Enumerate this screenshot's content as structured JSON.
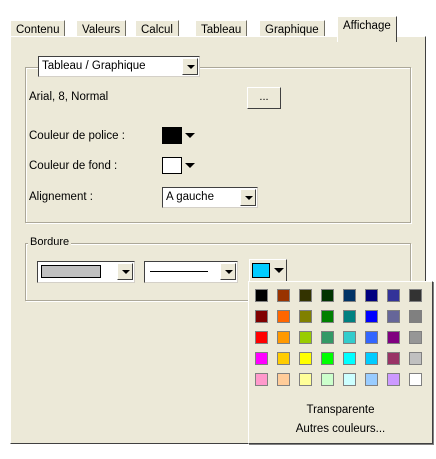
{
  "tabs": [
    "Contenu",
    "Valeurs",
    "Calcul",
    "Tableau",
    "Graphique",
    "Affichage"
  ],
  "active_tab": "Affichage",
  "group1": {
    "target_select": "Tableau / Graphique",
    "font_desc": "Arial, 8, Normal",
    "font_button": "...",
    "font_color_label": "Couleur de police :",
    "font_color": "#000000",
    "bg_color_label": "Couleur de fond :",
    "bg_color": "#ffffff",
    "align_label": "Alignement :",
    "align_value": "A gauche"
  },
  "border": {
    "legend": "Bordure",
    "fill_color": "#c0c0c0",
    "line_color": "#00ccff"
  },
  "palette": {
    "colors": [
      [
        "#000000",
        "#993300",
        "#333300",
        "#003300",
        "#003366",
        "#000080",
        "#333399",
        "#333333"
      ],
      [
        "#800000",
        "#ff6600",
        "#808000",
        "#008000",
        "#008080",
        "#0000ff",
        "#666699",
        "#808080"
      ],
      [
        "#ff0000",
        "#ff9900",
        "#99cc00",
        "#339966",
        "#33cccc",
        "#3366ff",
        "#800080",
        "#969696"
      ],
      [
        "#ff00ff",
        "#ffcc00",
        "#ffff00",
        "#00ff00",
        "#00ffff",
        "#00ccff",
        "#993366",
        "#c0c0c0"
      ],
      [
        "#ff99cc",
        "#ffcc99",
        "#ffff99",
        "#ccffcc",
        "#ccffff",
        "#99ccff",
        "#cc99ff",
        "#ffffff"
      ]
    ],
    "transparent_label": "Transparente",
    "more_label": "Autres couleurs..."
  }
}
